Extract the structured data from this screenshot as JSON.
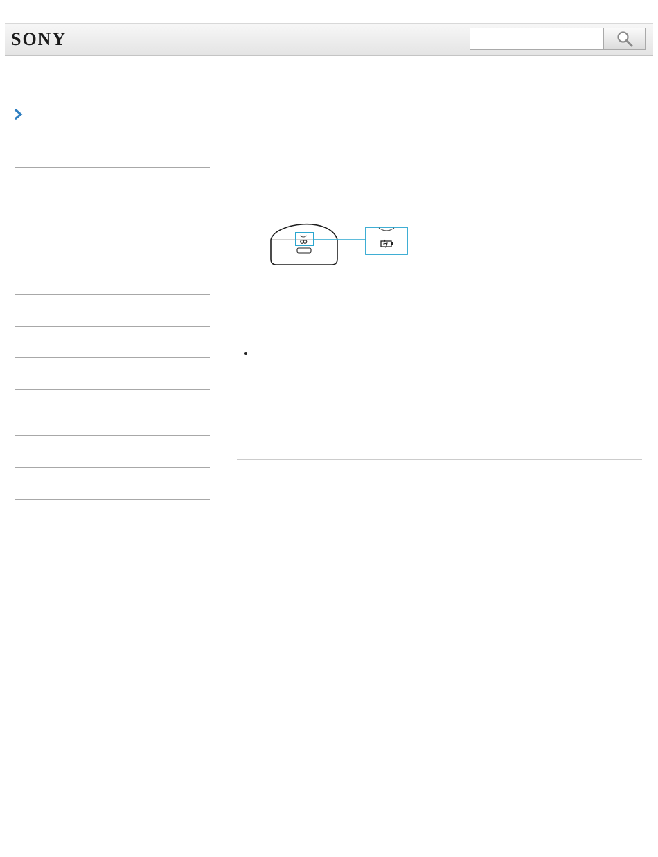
{
  "header": {
    "brand": "SONY",
    "search": {
      "value": "",
      "placeholder": ""
    },
    "search_button_icon": "search-icon"
  },
  "sidebar": {
    "back_icon": "chevron-right-icon",
    "accent_color": "#2f7fc1",
    "items": [
      {
        "label": ""
      },
      {
        "label": ""
      },
      {
        "label": ""
      },
      {
        "label": ""
      },
      {
        "label": ""
      },
      {
        "label": ""
      },
      {
        "label": ""
      },
      {
        "label": ""
      },
      {
        "label": ""
      },
      {
        "label": ""
      },
      {
        "label": ""
      },
      {
        "label": ""
      }
    ]
  },
  "main": {
    "illustration": {
      "subject": "device-bottom-view",
      "highlight_color": "#2aa6cf",
      "callout_icon": "battery-charging-icon"
    },
    "bullet_items": [
      {
        "text": ""
      }
    ],
    "section_dividers": 2
  }
}
